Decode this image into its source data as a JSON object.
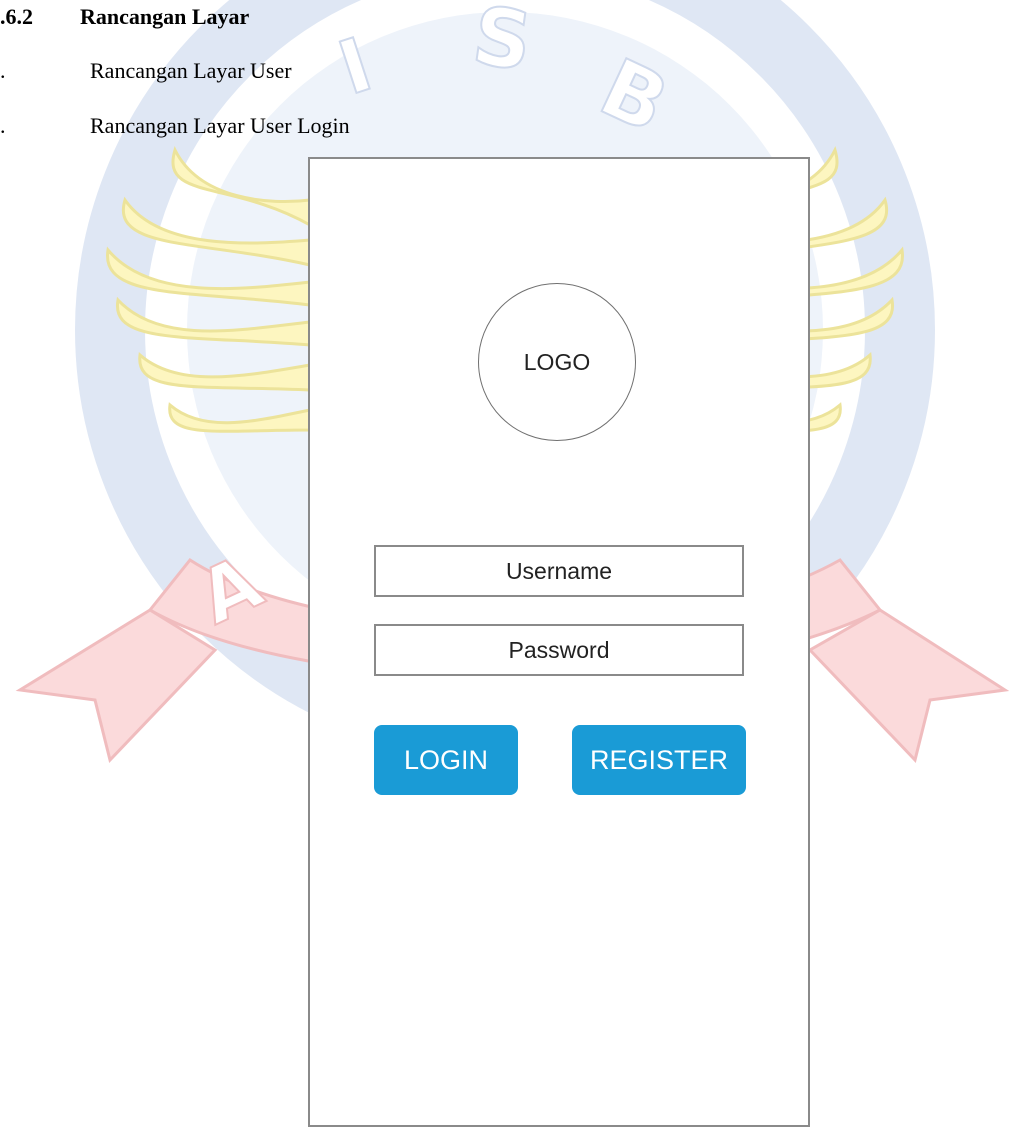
{
  "document": {
    "section_number": ".6.2",
    "section_title": "Rancangan Layar",
    "items": [
      {
        "marker": ".",
        "text": "Rancangan Layar User"
      },
      {
        "marker": ".",
        "text": "Rancangan Layar User Login"
      }
    ]
  },
  "mockup": {
    "logo_label": "LOGO",
    "username_placeholder": "Username",
    "password_placeholder": "Password",
    "login_label": "LOGIN",
    "register_label": "REGISTER",
    "button_color": "#1a9bd6"
  },
  "watermark": {
    "letters": [
      "S",
      "B",
      "A"
    ]
  }
}
